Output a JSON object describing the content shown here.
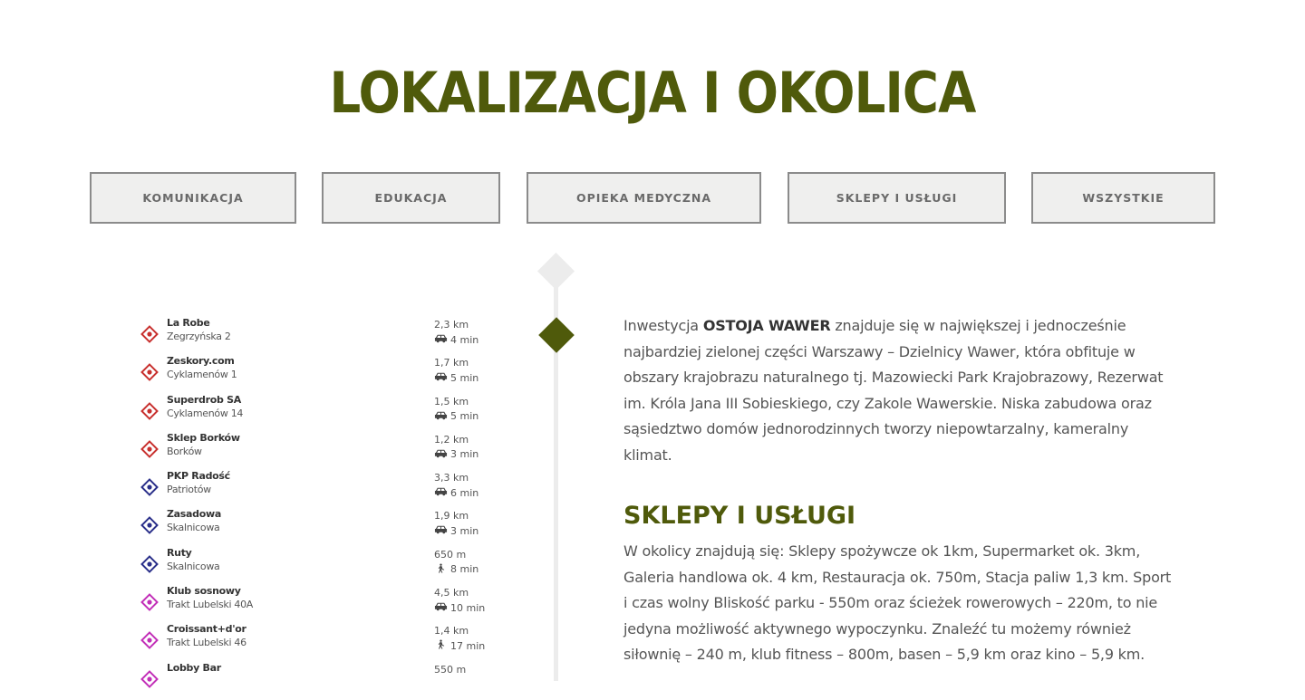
{
  "page_title": "LOKALIZACJA I OKOLICA",
  "filters": [
    {
      "label": "KOMUNIKACJA"
    },
    {
      "label": "EDUKACJA"
    },
    {
      "label": "OPIEKA MEDYCZNA"
    },
    {
      "label": "SKLEPY I USŁUGI"
    },
    {
      "label": "WSZYSTKIE"
    }
  ],
  "colors": {
    "brand_green": "#4f5a0b",
    "shop_icon": "#c8302e",
    "transport_icon": "#2a2f8a",
    "leisure_icon": "#c22fb8"
  },
  "places": [
    {
      "name": "La Robe",
      "address": "Zegrzyńska 2",
      "distance": "2,3 km",
      "time": "4 min",
      "mode": "car-icon",
      "category": "shop"
    },
    {
      "name": "Zeskory.com",
      "address": "Cyklamenów 1",
      "distance": "1,7 km",
      "time": "5 min",
      "mode": "car-icon",
      "category": "shop"
    },
    {
      "name": "Superdrob SA",
      "address": "Cyklamenów 14",
      "distance": "1,5 km",
      "time": "5 min",
      "mode": "car-icon",
      "category": "shop"
    },
    {
      "name": "Sklep Borków",
      "address": "Borków",
      "distance": "1,2 km",
      "time": "3 min",
      "mode": "car-icon",
      "category": "shop"
    },
    {
      "name": "PKP Radość",
      "address": "Patriotów",
      "distance": "3,3 km",
      "time": "6 min",
      "mode": "car-icon",
      "category": "transport"
    },
    {
      "name": "Zasadowa",
      "address": "Skalnicowa",
      "distance": "1,9 km",
      "time": "3 min",
      "mode": "car-icon",
      "category": "transport"
    },
    {
      "name": "Ruty",
      "address": "Skalnicowa",
      "distance": "650 m",
      "time": "8 min",
      "mode": "walk-icon",
      "category": "transport"
    },
    {
      "name": "Klub sosnowy",
      "address": "Trakt Lubelski 40A",
      "distance": "4,5 km",
      "time": "10 min",
      "mode": "car-icon",
      "category": "leisure"
    },
    {
      "name": "Croissant+d'or",
      "address": "Trakt Lubelski 46",
      "distance": "1,4 km",
      "time": "17 min",
      "mode": "walk-icon",
      "category": "leisure"
    },
    {
      "name": "Lobby Bar",
      "address": "",
      "distance": "550 m",
      "time": "",
      "mode": "walk-icon",
      "category": "leisure"
    }
  ],
  "intro": {
    "before": "Inwestycja ",
    "highlight": "OSTOJA WAWER",
    "after": " znajduje się w największej i jednocześnie najbardziej zielonej części Warszawy – Dzielnicy Wawer, która obfituje w obszary krajobrazu naturalnego tj. Mazowiecki Park Krajobrazowy, Rezerwat im. Króla Jana III Sobieskiego, czy Zakole Wawerskie. Niska zabudowa oraz sąsiedztwo domów jednorodzinnych tworzy niepowtarzalny, kameralny klimat."
  },
  "section": {
    "title": "SKLEPY I USŁUGI",
    "text": "W okolicy znajdują się: Sklepy spożywcze ok 1km, Supermarket ok. 3km, Galeria handlowa ok. 4 km, Restauracja ok. 750m, Stacja paliw 1,3 km. Sport i czas wolny Bliskość parku - 550m oraz ścieżek rowerowych – 220m, to nie jedyna możliwość aktywnego wypoczynku. Znaleźć tu możemy również siłownię – 240 m, klub fitness – 800m, basen – 5,9 km oraz kino – 5,9 km."
  }
}
